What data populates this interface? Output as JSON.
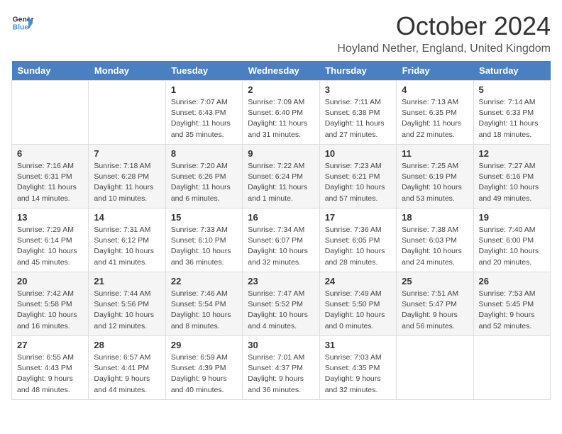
{
  "logo": {
    "line1": "General",
    "line2": "Blue"
  },
  "title": "October 2024",
  "location": "Hoyland Nether, England, United Kingdom",
  "days_of_week": [
    "Sunday",
    "Monday",
    "Tuesday",
    "Wednesday",
    "Thursday",
    "Friday",
    "Saturday"
  ],
  "weeks": [
    [
      {
        "day": "",
        "info": ""
      },
      {
        "day": "",
        "info": ""
      },
      {
        "day": "1",
        "info": "Sunrise: 7:07 AM\nSunset: 6:43 PM\nDaylight: 11 hours and 35 minutes."
      },
      {
        "day": "2",
        "info": "Sunrise: 7:09 AM\nSunset: 6:40 PM\nDaylight: 11 hours and 31 minutes."
      },
      {
        "day": "3",
        "info": "Sunrise: 7:11 AM\nSunset: 6:38 PM\nDaylight: 11 hours and 27 minutes."
      },
      {
        "day": "4",
        "info": "Sunrise: 7:13 AM\nSunset: 6:35 PM\nDaylight: 11 hours and 22 minutes."
      },
      {
        "day": "5",
        "info": "Sunrise: 7:14 AM\nSunset: 6:33 PM\nDaylight: 11 hours and 18 minutes."
      }
    ],
    [
      {
        "day": "6",
        "info": "Sunrise: 7:16 AM\nSunset: 6:31 PM\nDaylight: 11 hours and 14 minutes."
      },
      {
        "day": "7",
        "info": "Sunrise: 7:18 AM\nSunset: 6:28 PM\nDaylight: 11 hours and 10 minutes."
      },
      {
        "day": "8",
        "info": "Sunrise: 7:20 AM\nSunset: 6:26 PM\nDaylight: 11 hours and 6 minutes."
      },
      {
        "day": "9",
        "info": "Sunrise: 7:22 AM\nSunset: 6:24 PM\nDaylight: 11 hours and 1 minute."
      },
      {
        "day": "10",
        "info": "Sunrise: 7:23 AM\nSunset: 6:21 PM\nDaylight: 10 hours and 57 minutes."
      },
      {
        "day": "11",
        "info": "Sunrise: 7:25 AM\nSunset: 6:19 PM\nDaylight: 10 hours and 53 minutes."
      },
      {
        "day": "12",
        "info": "Sunrise: 7:27 AM\nSunset: 6:16 PM\nDaylight: 10 hours and 49 minutes."
      }
    ],
    [
      {
        "day": "13",
        "info": "Sunrise: 7:29 AM\nSunset: 6:14 PM\nDaylight: 10 hours and 45 minutes."
      },
      {
        "day": "14",
        "info": "Sunrise: 7:31 AM\nSunset: 6:12 PM\nDaylight: 10 hours and 41 minutes."
      },
      {
        "day": "15",
        "info": "Sunrise: 7:33 AM\nSunset: 6:10 PM\nDaylight: 10 hours and 36 minutes."
      },
      {
        "day": "16",
        "info": "Sunrise: 7:34 AM\nSunset: 6:07 PM\nDaylight: 10 hours and 32 minutes."
      },
      {
        "day": "17",
        "info": "Sunrise: 7:36 AM\nSunset: 6:05 PM\nDaylight: 10 hours and 28 minutes."
      },
      {
        "day": "18",
        "info": "Sunrise: 7:38 AM\nSunset: 6:03 PM\nDaylight: 10 hours and 24 minutes."
      },
      {
        "day": "19",
        "info": "Sunrise: 7:40 AM\nSunset: 6:00 PM\nDaylight: 10 hours and 20 minutes."
      }
    ],
    [
      {
        "day": "20",
        "info": "Sunrise: 7:42 AM\nSunset: 5:58 PM\nDaylight: 10 hours and 16 minutes."
      },
      {
        "day": "21",
        "info": "Sunrise: 7:44 AM\nSunset: 5:56 PM\nDaylight: 10 hours and 12 minutes."
      },
      {
        "day": "22",
        "info": "Sunrise: 7:46 AM\nSunset: 5:54 PM\nDaylight: 10 hours and 8 minutes."
      },
      {
        "day": "23",
        "info": "Sunrise: 7:47 AM\nSunset: 5:52 PM\nDaylight: 10 hours and 4 minutes."
      },
      {
        "day": "24",
        "info": "Sunrise: 7:49 AM\nSunset: 5:50 PM\nDaylight: 10 hours and 0 minutes."
      },
      {
        "day": "25",
        "info": "Sunrise: 7:51 AM\nSunset: 5:47 PM\nDaylight: 9 hours and 56 minutes."
      },
      {
        "day": "26",
        "info": "Sunrise: 7:53 AM\nSunset: 5:45 PM\nDaylight: 9 hours and 52 minutes."
      }
    ],
    [
      {
        "day": "27",
        "info": "Sunrise: 6:55 AM\nSunset: 4:43 PM\nDaylight: 9 hours and 48 minutes."
      },
      {
        "day": "28",
        "info": "Sunrise: 6:57 AM\nSunset: 4:41 PM\nDaylight: 9 hours and 44 minutes."
      },
      {
        "day": "29",
        "info": "Sunrise: 6:59 AM\nSunset: 4:39 PM\nDaylight: 9 hours and 40 minutes."
      },
      {
        "day": "30",
        "info": "Sunrise: 7:01 AM\nSunset: 4:37 PM\nDaylight: 9 hours and 36 minutes."
      },
      {
        "day": "31",
        "info": "Sunrise: 7:03 AM\nSunset: 4:35 PM\nDaylight: 9 hours and 32 minutes."
      },
      {
        "day": "",
        "info": ""
      },
      {
        "day": "",
        "info": ""
      }
    ]
  ]
}
